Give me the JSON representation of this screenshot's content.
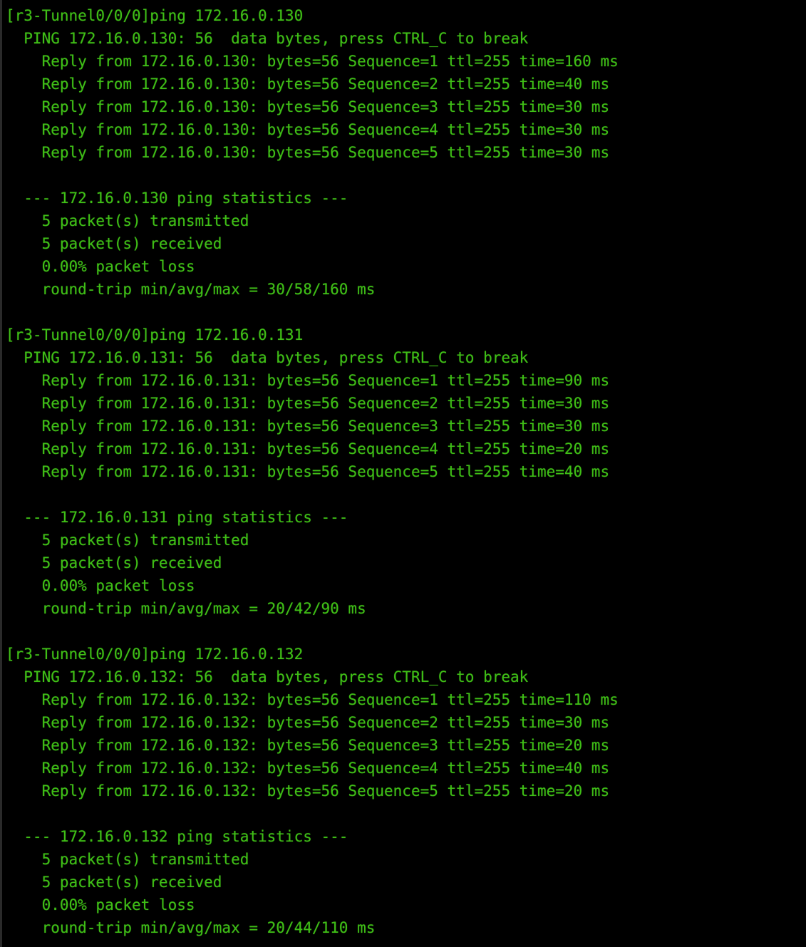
{
  "terminal": {
    "device_prompt": "[r3-Tunnel0/0/0]",
    "foreground_color": "#3fbf16",
    "background_color": "#000000",
    "columns": 70,
    "rows": 41
  },
  "sessions": [
    {
      "prompt_line": "[r3-Tunnel0/0/0]ping 172.16.0.130",
      "ping_header": "  PING 172.16.0.130: 56  data bytes, press CTRL_C to break",
      "target": "172.16.0.130",
      "replies": [
        "    Reply from 172.16.0.130: bytes=56 Sequence=1 ttl=255 time=160 ms",
        "    Reply from 172.16.0.130: bytes=56 Sequence=2 ttl=255 time=40 ms",
        "    Reply from 172.16.0.130: bytes=56 Sequence=3 ttl=255 time=30 ms",
        "    Reply from 172.16.0.130: bytes=56 Sequence=4 ttl=255 time=30 ms",
        "    Reply from 172.16.0.130: bytes=56 Sequence=5 ttl=255 time=30 ms"
      ],
      "stats_header": "  --- 172.16.0.130 ping statistics ---",
      "stats": [
        "    5 packet(s) transmitted",
        "    5 packet(s) received",
        "    0.00% packet loss",
        "    round-trip min/avg/max = 30/58/160 ms"
      ]
    },
    {
      "prompt_line": "[r3-Tunnel0/0/0]ping 172.16.0.131",
      "ping_header": "  PING 172.16.0.131: 56  data bytes, press CTRL_C to break",
      "target": "172.16.0.131",
      "replies": [
        "    Reply from 172.16.0.131: bytes=56 Sequence=1 ttl=255 time=90 ms",
        "    Reply from 172.16.0.131: bytes=56 Sequence=2 ttl=255 time=30 ms",
        "    Reply from 172.16.0.131: bytes=56 Sequence=3 ttl=255 time=30 ms",
        "    Reply from 172.16.0.131: bytes=56 Sequence=4 ttl=255 time=20 ms",
        "    Reply from 172.16.0.131: bytes=56 Sequence=5 ttl=255 time=40 ms"
      ],
      "stats_header": "  --- 172.16.0.131 ping statistics ---",
      "stats": [
        "    5 packet(s) transmitted",
        "    5 packet(s) received",
        "    0.00% packet loss",
        "    round-trip min/avg/max = 20/42/90 ms"
      ]
    },
    {
      "prompt_line": "[r3-Tunnel0/0/0]ping 172.16.0.132",
      "ping_header": "  PING 172.16.0.132: 56  data bytes, press CTRL_C to break",
      "target": "172.16.0.132",
      "replies": [
        "    Reply from 172.16.0.132: bytes=56 Sequence=1 ttl=255 time=110 ms",
        "    Reply from 172.16.0.132: bytes=56 Sequence=2 ttl=255 time=30 ms",
        "    Reply from 172.16.0.132: bytes=56 Sequence=3 ttl=255 time=20 ms",
        "    Reply from 172.16.0.132: bytes=56 Sequence=4 ttl=255 time=40 ms",
        "    Reply from 172.16.0.132: bytes=56 Sequence=5 ttl=255 time=20 ms"
      ],
      "stats_header": "  --- 172.16.0.132 ping statistics ---",
      "stats": [
        "    5 packet(s) transmitted",
        "    5 packet(s) received",
        "    0.00% packet loss",
        "    round-trip min/avg/max = 20/44/110 ms"
      ]
    }
  ],
  "lines": [
    "[r3-Tunnel0/0/0]ping 172.16.0.130",
    "  PING 172.16.0.130: 56  data bytes, press CTRL_C to break",
    "    Reply from 172.16.0.130: bytes=56 Sequence=1 ttl=255 time=160 ms",
    "    Reply from 172.16.0.130: bytes=56 Sequence=2 ttl=255 time=40 ms",
    "    Reply from 172.16.0.130: bytes=56 Sequence=3 ttl=255 time=30 ms",
    "    Reply from 172.16.0.130: bytes=56 Sequence=4 ttl=255 time=30 ms",
    "    Reply from 172.16.0.130: bytes=56 Sequence=5 ttl=255 time=30 ms",
    "",
    "  --- 172.16.0.130 ping statistics ---",
    "    5 packet(s) transmitted",
    "    5 packet(s) received",
    "    0.00% packet loss",
    "    round-trip min/avg/max = 30/58/160 ms",
    "",
    "[r3-Tunnel0/0/0]ping 172.16.0.131",
    "  PING 172.16.0.131: 56  data bytes, press CTRL_C to break",
    "    Reply from 172.16.0.131: bytes=56 Sequence=1 ttl=255 time=90 ms",
    "    Reply from 172.16.0.131: bytes=56 Sequence=2 ttl=255 time=30 ms",
    "    Reply from 172.16.0.131: bytes=56 Sequence=3 ttl=255 time=30 ms",
    "    Reply from 172.16.0.131: bytes=56 Sequence=4 ttl=255 time=20 ms",
    "    Reply from 172.16.0.131: bytes=56 Sequence=5 ttl=255 time=40 ms",
    "",
    "  --- 172.16.0.131 ping statistics ---",
    "    5 packet(s) transmitted",
    "    5 packet(s) received",
    "    0.00% packet loss",
    "    round-trip min/avg/max = 20/42/90 ms",
    "",
    "[r3-Tunnel0/0/0]ping 172.16.0.132",
    "  PING 172.16.0.132: 56  data bytes, press CTRL_C to break",
    "    Reply from 172.16.0.132: bytes=56 Sequence=1 ttl=255 time=110 ms",
    "    Reply from 172.16.0.132: bytes=56 Sequence=2 ttl=255 time=30 ms",
    "    Reply from 172.16.0.132: bytes=56 Sequence=3 ttl=255 time=20 ms",
    "    Reply from 172.16.0.132: bytes=56 Sequence=4 ttl=255 time=40 ms",
    "    Reply from 172.16.0.132: bytes=56 Sequence=5 ttl=255 time=20 ms",
    "",
    "  --- 172.16.0.132 ping statistics ---",
    "    5 packet(s) transmitted",
    "    5 packet(s) received",
    "    0.00% packet loss",
    "    round-trip min/avg/max = 20/44/110 ms"
  ]
}
